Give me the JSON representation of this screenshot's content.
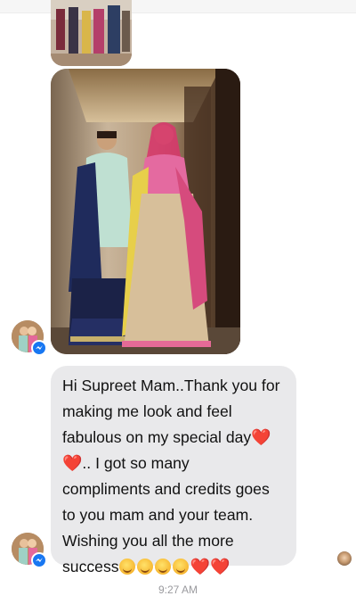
{
  "chat": {
    "message_lines": [
      "Hi Supreet Mam..Thank you for",
      "making me look and feel",
      "fabulous on my special day",
      ".. I got so many",
      "compliments and credits goes",
      "to you mam and your team.",
      "Wishing you all the more",
      "success"
    ],
    "emoji": {
      "heart": "❤️"
    },
    "timestamp": "9:27 AM"
  },
  "icons": {
    "messenger_badge": "messenger-icon",
    "heart": "red-heart-emoji",
    "hug_face": "hugging-face-emoji",
    "smiling_hearts": "smiling-face-with-hearts-emoji"
  },
  "colors": {
    "bubble_bg": "#e9e9eb",
    "messenger_blue": "#1877f2",
    "timestamp": "#9a9a9e"
  }
}
